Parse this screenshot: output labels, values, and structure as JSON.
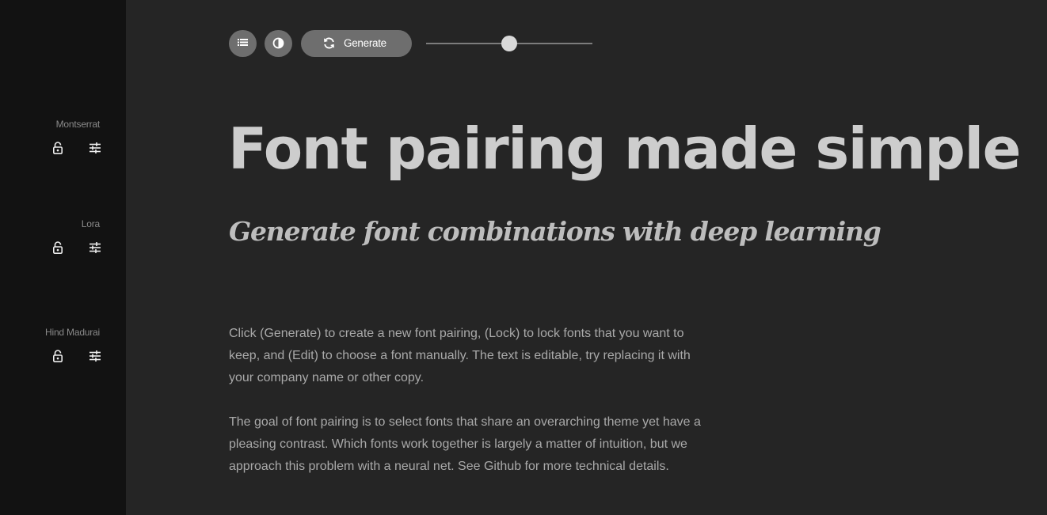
{
  "sidebar": {
    "fonts": [
      {
        "name": "Montserrat"
      },
      {
        "name": "Lora"
      },
      {
        "name": "Hind Madurai"
      }
    ]
  },
  "toolbar": {
    "generate_label": "Generate",
    "slider_value": 0.5
  },
  "content": {
    "headline": "Font pairing made simple",
    "subheadline": "Generate font combinations with deep learning",
    "paragraphs": [
      "Click (Generate) to create a new font pairing, (Lock) to lock fonts that you want to keep, and (Edit) to choose a font manually. The text is editable, try replacing it with your company name or other copy.",
      "The goal of font pairing is to select fonts that share an overarching theme yet have a pleasing contrast. Which fonts work together is largely a matter of intuition, but we approach this problem with a neural net. See Github for more technical details."
    ]
  },
  "icons": {
    "list": "list-icon",
    "contrast": "contrast-icon",
    "refresh": "refresh-icon",
    "lock": "unlock-icon",
    "edit": "sliders-icon"
  },
  "colors": {
    "background": "#252525",
    "sidebar": "#121212",
    "button": "#6e6e6e",
    "headline": "#cdcdcd",
    "body": "#a9a9a9"
  }
}
